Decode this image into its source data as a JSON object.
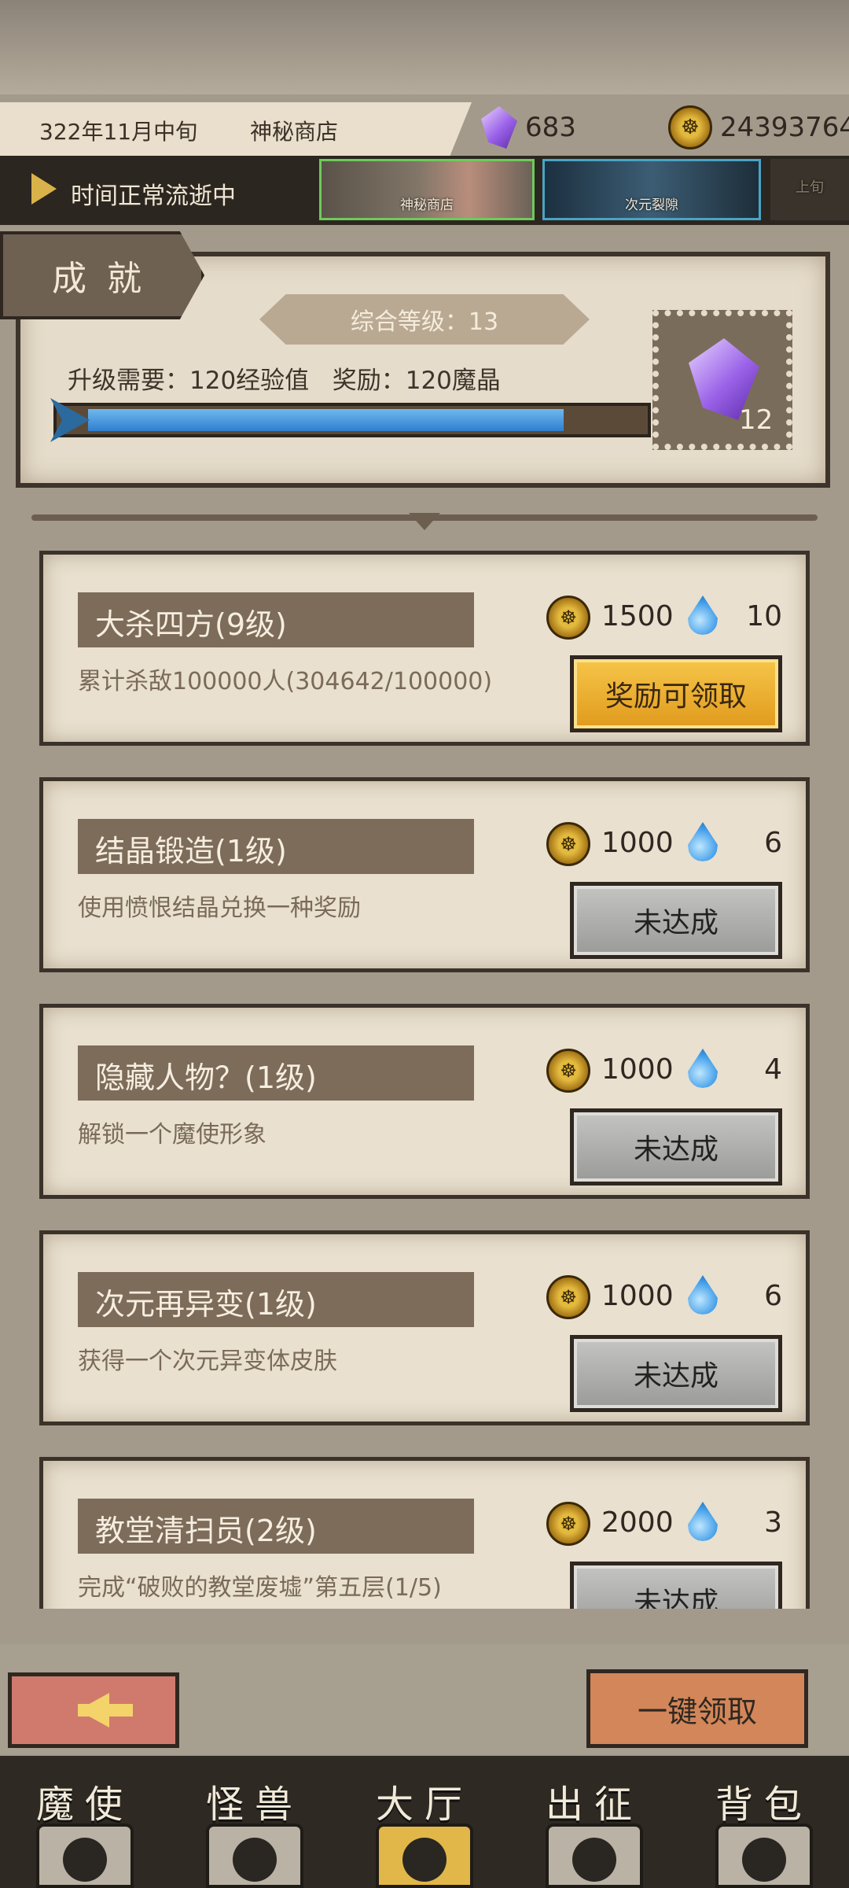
{
  "header": {
    "date": "322年11月中旬",
    "location": "神秘商店",
    "crystals": "683",
    "gold": "24393764",
    "status": "时间正常流逝中",
    "events": [
      {
        "label": "神秘商店"
      },
      {
        "label": "次元裂隙"
      },
      {
        "label": "上旬"
      }
    ]
  },
  "page_title": "成 就",
  "summary": {
    "level_text": "综合等级：13",
    "requirement_text": "升级需要：120经验值   奖励：120魔晶",
    "progress": 0.85,
    "reward_count": "12"
  },
  "achievements": [
    {
      "name": "大杀四方(9级)",
      "desc": "累计杀敌100000人(304642/100000)",
      "gold": "1500",
      "drops": "10",
      "button": "奖励可领取",
      "claimable": true
    },
    {
      "name": "结晶锻造(1级)",
      "desc": "使用愤恨结晶兑换一种奖励",
      "gold": "1000",
      "drops": "6",
      "button": "未达成",
      "claimable": false
    },
    {
      "name": "隐藏人物？(1级)",
      "desc": "解锁一个魔使形象",
      "gold": "1000",
      "drops": "4",
      "button": "未达成",
      "claimable": false
    },
    {
      "name": "次元再异变(1级)",
      "desc": "获得一个次元异变体皮肤",
      "gold": "1000",
      "drops": "6",
      "button": "未达成",
      "claimable": false
    },
    {
      "name": "教堂清扫员(2级)",
      "desc": "完成“破败的教堂废墟”第五层(1/5)",
      "gold": "2000",
      "drops": "3",
      "button": "未达成",
      "claimable": false
    }
  ],
  "claim_all": "一键领取",
  "nav": [
    {
      "label": "魔使",
      "icon": "skull-icon"
    },
    {
      "label": "怪兽",
      "icon": "monster-icon"
    },
    {
      "label": "大厅",
      "icon": "hall-icon",
      "active": true
    },
    {
      "label": "出征",
      "icon": "battle-icon"
    },
    {
      "label": "背包",
      "icon": "backpack-icon"
    }
  ],
  "colors": {
    "claim_button": "#e8a62a",
    "locked_button": "#a9a9a7",
    "progress": "#3a8ad8",
    "panel": "#e6dccb"
  }
}
